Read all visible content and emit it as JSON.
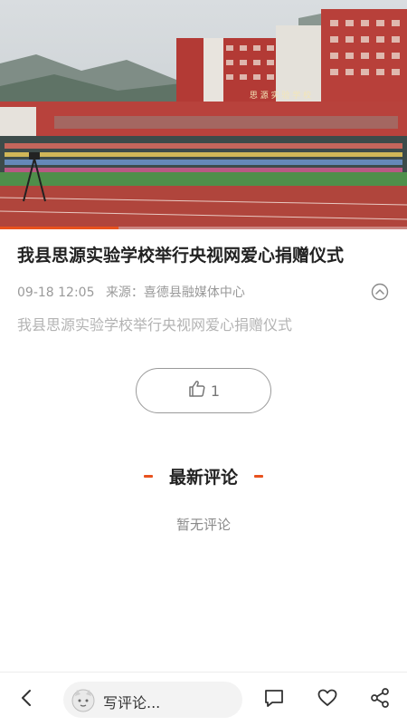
{
  "video": {
    "progress": 0.29,
    "banner_text": "思 源 实 验 学 校"
  },
  "article": {
    "title": "我县思源实验学校举行央视网爱心捐赠仪式",
    "date": "09-18 12:05",
    "source_label": "来源：喜德县融媒体中心",
    "summary": "我县思源实验学校举行央视网爱心捐赠仪式"
  },
  "like": {
    "count": "1"
  },
  "comments": {
    "section_title": "最新评论",
    "empty_text": "暂无评论"
  },
  "bottom_bar": {
    "input_placeholder": "写评论..."
  },
  "colors": {
    "accent": "#e8521e",
    "text_primary": "#222222",
    "text_meta": "#9a9a9a"
  }
}
